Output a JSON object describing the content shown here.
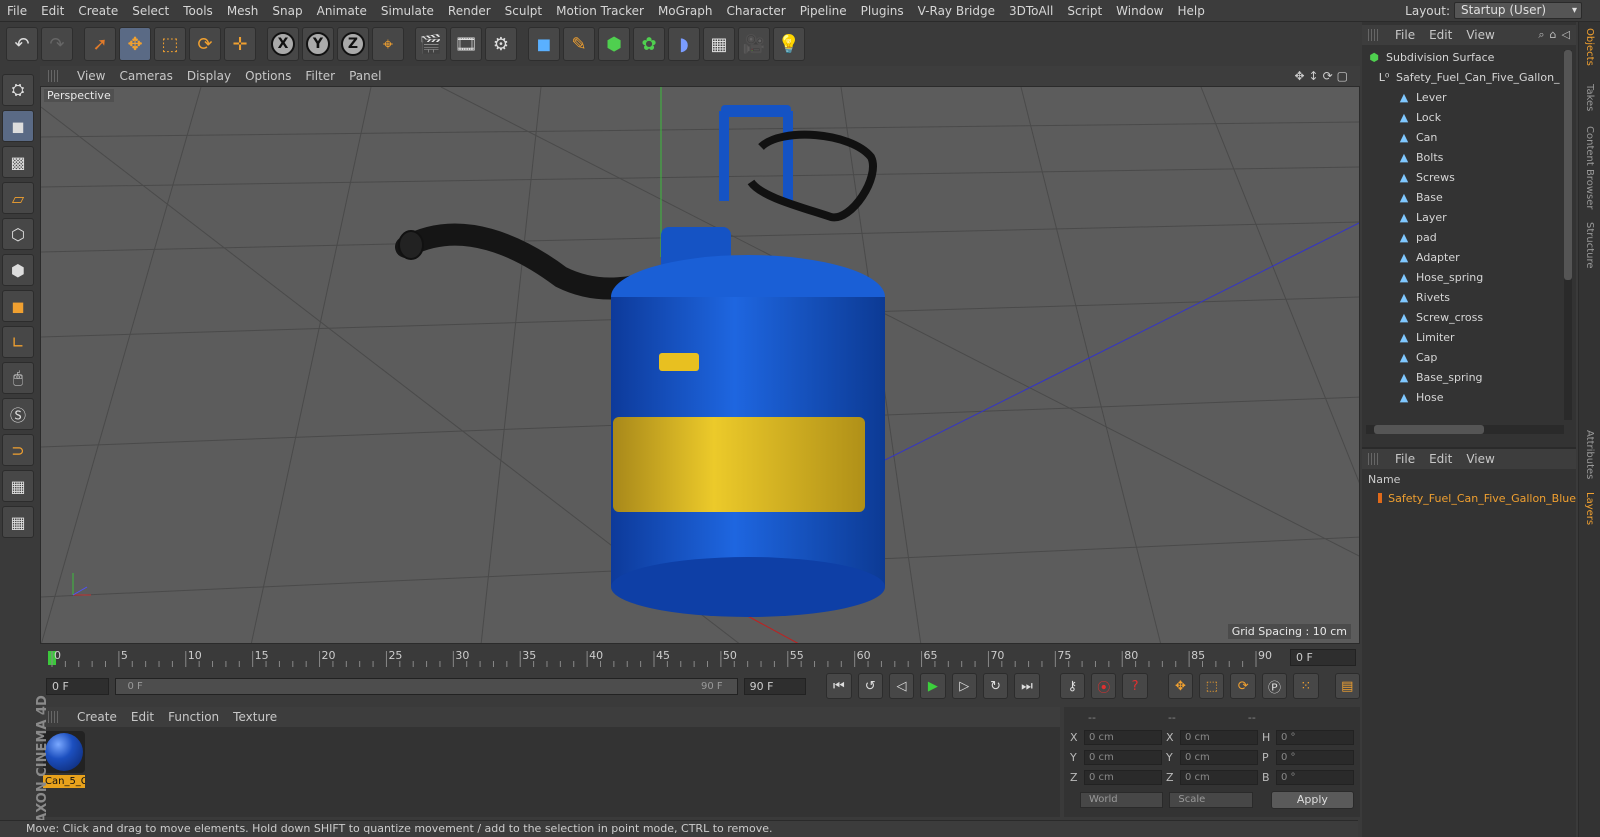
{
  "menu": [
    "File",
    "Edit",
    "Create",
    "Select",
    "Tools",
    "Mesh",
    "Snap",
    "Animate",
    "Simulate",
    "Render",
    "Sculpt",
    "Motion Tracker",
    "MoGraph",
    "Character",
    "Pipeline",
    "Plugins",
    "V-Ray Bridge",
    "3DToAll",
    "Script",
    "Window",
    "Help"
  ],
  "layout": {
    "label": "Layout:",
    "value": "Startup (User)"
  },
  "viewport": {
    "menu": [
      "View",
      "Cameras",
      "Display",
      "Options",
      "Filter",
      "Panel"
    ],
    "camera": "Perspective",
    "grid_spacing": "Grid Spacing : 10 cm"
  },
  "timeline": {
    "ticks": [
      "0",
      "5",
      "10",
      "15",
      "20",
      "25",
      "30",
      "35",
      "40",
      "45",
      "50",
      "55",
      "60",
      "65",
      "70",
      "75",
      "80",
      "85",
      "90"
    ],
    "current_frame": "0 F",
    "start_field": "0 F",
    "slider_left": "0 F",
    "slider_right": "90 F",
    "end_field": "90 F"
  },
  "material_manager": {
    "menu": [
      "Create",
      "Edit",
      "Function",
      "Texture"
    ],
    "material_name": "Can_5_G"
  },
  "branding": "MAXON CINEMA 4D",
  "coordinates": {
    "headers": [
      "--",
      "--",
      "--"
    ],
    "rows": [
      {
        "a1": "X",
        "v1": "0 cm",
        "a2": "X",
        "v2": "0 cm",
        "a3": "H",
        "v3": "0 °"
      },
      {
        "a1": "Y",
        "v1": "0 cm",
        "a2": "Y",
        "v2": "0 cm",
        "a3": "P",
        "v3": "0 °"
      },
      {
        "a1": "Z",
        "v1": "0 cm",
        "a2": "Z",
        "v2": "0 cm",
        "a3": "B",
        "v3": "0 °"
      }
    ],
    "mode": "World",
    "scale": "Scale",
    "apply": "Apply"
  },
  "status": "Move: Click and drag to move elements. Hold down SHIFT to quantize movement / add to the selection in point mode, CTRL to remove.",
  "objects_panel": {
    "menu": [
      "File",
      "Edit",
      "View"
    ],
    "items": [
      "Subdivision Surface",
      "Safety_Fuel_Can_Five_Gallon_",
      "Lever",
      "Lock",
      "Can",
      "Bolts",
      "Screws",
      "Base",
      "Layer",
      "pad",
      "Adapter",
      "Hose_spring",
      "Rivets",
      "Screw_cross",
      "Limiter",
      "Cap",
      "Base_spring",
      "Hose"
    ]
  },
  "layers_panel": {
    "menu": [
      "File",
      "Edit",
      "View"
    ],
    "col_name": "Name",
    "layer": "Safety_Fuel_Can_Five_Gallon_Blue"
  },
  "side_tabs": [
    "Objects",
    "Takes",
    "Content Browser",
    "Structure",
    "Attributes",
    "Layers"
  ],
  "colors": {
    "accent": "#f0a030",
    "can_blue": "#1a5fd6",
    "label_yellow": "#e8c020",
    "bg": "#3a3a3a"
  }
}
